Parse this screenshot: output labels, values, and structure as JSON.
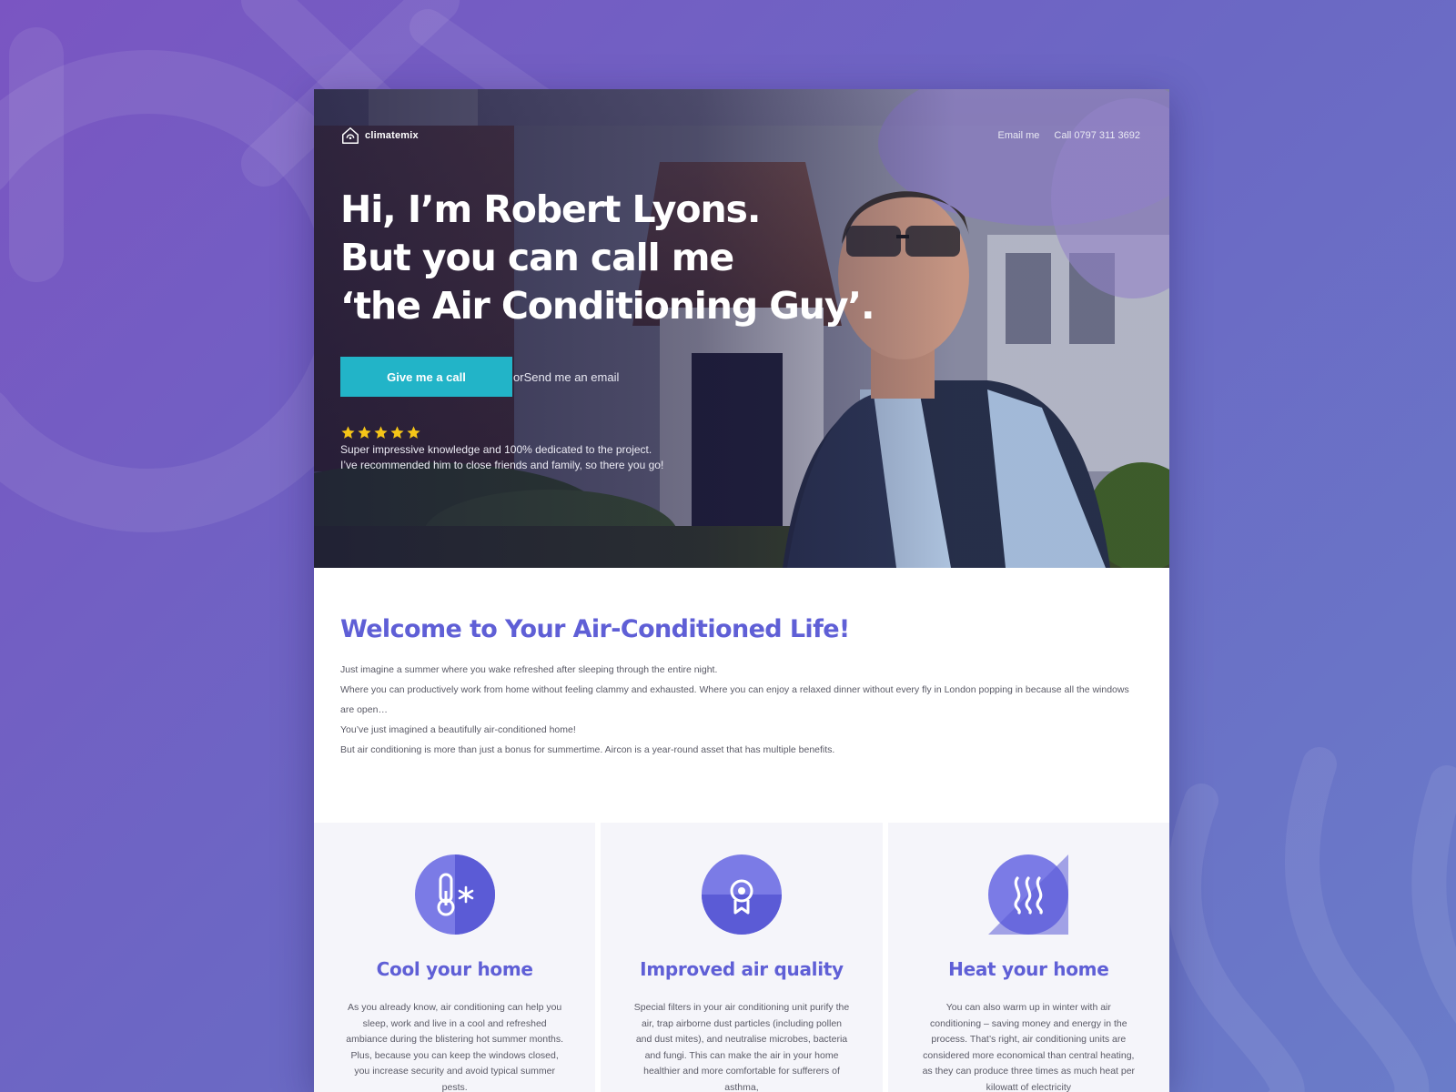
{
  "brand": {
    "logo_text": "climatemix"
  },
  "nav": {
    "email_label": "Email me",
    "call_label": "Call 0797 311 3692"
  },
  "hero": {
    "headline_line1": "Hi, I’m Robert Lyons.",
    "headline_line2": "But you can call me",
    "headline_line3": "‘the Air Conditioning Guy’.",
    "call_button": "Give me a call",
    "or_text": "or",
    "email_link": "Send me an email",
    "rating_stars": 5,
    "review_line1": "Super impressive knowledge and 100% dedicated to the project.",
    "review_line2": "I’ve recommended him to close friends and family, so there you go!"
  },
  "welcome": {
    "title": "Welcome to Your Air-Conditioned Life!",
    "paragraphs": [
      "Just imagine a summer where you wake refreshed after sleeping through the entire night.",
      "Where you can productively work from home without feeling clammy and exhausted. Where you can enjoy a relaxed dinner without every fly in London popping in because all the windows are open…",
      "You’ve just imagined a beautifully air-conditioned home!",
      "But air conditioning is more than just a bonus for summertime. Aircon is a year-round asset that has multiple benefits."
    ]
  },
  "features": [
    {
      "icon": "thermometer-snowflake-icon",
      "title": "Cool your home",
      "text": "As you already know, air conditioning can help you sleep, work and live in a cool and refreshed ambiance during the blistering hot summer months. Plus, because you can keep the windows closed, you increase security and avoid typical summer pests."
    },
    {
      "icon": "award-badge-icon",
      "title": "Improved air quality",
      "text": "Special filters in your air conditioning unit purify the air, trap airborne dust particles (including pollen and dust mites), and neutralise microbes, bacteria and fungi. This can make the air in your home healthier and more comfortable for sufferers of asthma,"
    },
    {
      "icon": "heat-waves-icon",
      "title": "Heat your home",
      "text": "You can also warm up in winter with air conditioning – saving money and energy in the process. That’s right, air conditioning units are considered more economical than central heating, as they can produce three times as much heat per kilowatt of electricity"
    }
  ],
  "colors": {
    "accent": "#5f5fd6",
    "cta": "#22b4c8",
    "star": "#f5c518",
    "background": "#6b68c4"
  }
}
